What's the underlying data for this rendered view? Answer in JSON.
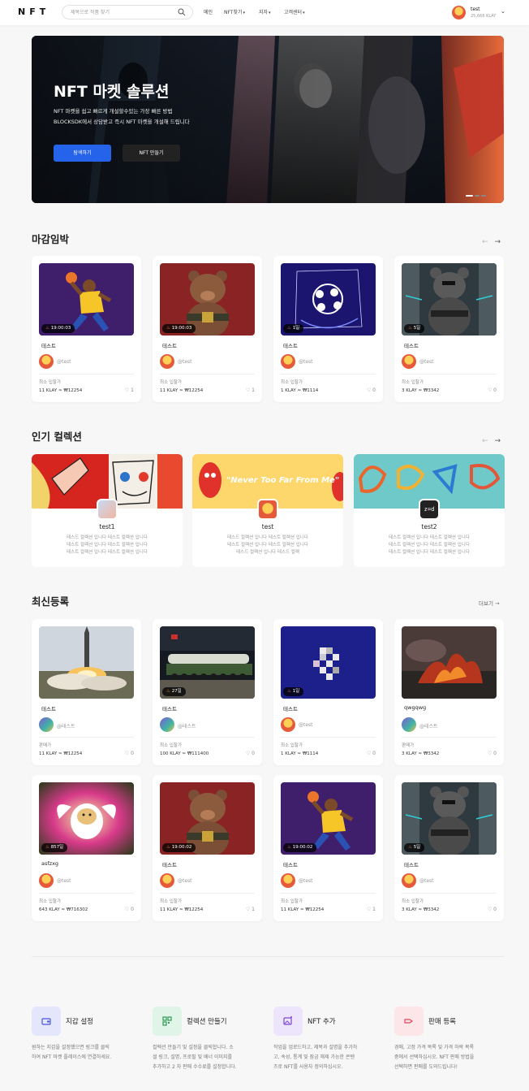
{
  "header": {
    "logo": "NFT",
    "search_placeholder": "제목으로 작품 찾기",
    "nav": [
      "메인",
      "NFT찾기",
      "지자",
      "고객센터"
    ],
    "user_name": "test",
    "user_balance": "25,666 KLAY"
  },
  "hero": {
    "title": "NFT 마켓 솔루션",
    "desc1": "NFT 마켓을 쉽고 빠르게 개설할수있는 가장 빠른 방법",
    "desc2": "BLOCKSDK에서 상담받고 즉시 NFT 마켓을 개설해 드립니다",
    "btn_explore": "탐색하기",
    "btn_create": "NFT 만들기"
  },
  "deadline": {
    "title": "마감임박",
    "cards": [
      {
        "badge": "19:00:03",
        "title": "테스트",
        "owner": "@test",
        "label": "최소 입찰가",
        "price": "11 KLAY ≈ ₩12254",
        "likes": "1"
      },
      {
        "badge": "19:00:03",
        "title": "테스트",
        "owner": "@test",
        "label": "최소 입찰가",
        "price": "11 KLAY ≈ ₩12254",
        "likes": "1"
      },
      {
        "badge": "1일",
        "title": "테스트",
        "owner": "@test",
        "label": "최소 입찰가",
        "price": "1 KLAY ≈ ₩1114",
        "likes": "0"
      },
      {
        "badge": "5일",
        "title": "테스트",
        "owner": "@test",
        "label": "최소 입찰가",
        "price": "3 KLAY ≈ ₩3342",
        "likes": "0"
      }
    ]
  },
  "popular": {
    "title": "인기 컬렉션",
    "banner2_text": "\"Never Too Far From Me\"",
    "logo3_text": "z=d",
    "collections": [
      {
        "name": "test1",
        "d1": "테스드 컬렉션 입니다 테스트 컬렉션 입니다",
        "d2": "테스트 컬렉션 입니다 테스트 컬렉션 입니다",
        "d3": "테스트 컬렉션 입니다 테스트 컬렉션 입니다"
      },
      {
        "name": "test",
        "d1": "테스드 컬렉션 입니다 테스트 컬렉션 입니다",
        "d2": "테스트 컬렉션 입니다 테스트 컬렉션 입니다",
        "d3": "테스드 컬렉션 입니다 테스드 컬렉"
      },
      {
        "name": "test2",
        "d1": "테스트 컬렉션 입니다 테스트 컬렉션 입니다",
        "d2": "테스트 컬렉션 입니다 테스트 컬렉션 입니다",
        "d3": "테스트 컬렉션 입니다 테스트 컬렉션 입니다"
      }
    ]
  },
  "latest": {
    "title": "최신등록",
    "more": "더보기",
    "cards": [
      {
        "badge": "",
        "title": "테스트",
        "owner": "@테스트",
        "label": "판매가",
        "price": "11 KLAY ≈ ₩12254",
        "likes": "0"
      },
      {
        "badge": "27일",
        "title": "테스트",
        "owner": "@테스트",
        "label": "최소 입찰가",
        "price": "100 KLAY ≈ ₩111400",
        "likes": "0"
      },
      {
        "badge": "1일",
        "title": "테스트",
        "owner": "@test",
        "label": "최소 입찰가",
        "price": "1 KLAY ≈ ₩1114",
        "likes": "0"
      },
      {
        "badge": "",
        "title": "qwgqwg",
        "owner": "@테스트",
        "label": "판매가",
        "price": "3 KLAY ≈ ₩3342",
        "likes": "0"
      },
      {
        "badge": "857일",
        "title": "asfzxg",
        "owner": "@test",
        "label": "최소 입찰가",
        "price": "643 KLAY ≈ ₩716302",
        "likes": "0"
      },
      {
        "badge": "19:00:02",
        "title": "테스트",
        "owner": "@test",
        "label": "최소 입찰가",
        "price": "11 KLAY ≈ ₩12254",
        "likes": "1"
      },
      {
        "badge": "19:00:02",
        "title": "테스트",
        "owner": "@test",
        "label": "최소 입찰가",
        "price": "11 KLAY ≈ ₩12254",
        "likes": "1"
      },
      {
        "badge": "5일",
        "title": "테스트",
        "owner": "@test",
        "label": "최소 입찰가",
        "price": "3 KLAY ≈ ₩3342",
        "likes": "0"
      }
    ]
  },
  "features": [
    {
      "title": "지갑 설정",
      "d1": "원하는 지갑을 설정했으면 링크를 클릭",
      "d2": "하여 NFT 마켓 플레이스에 연결하세요.",
      "d3": "",
      "color": "#e4e6fb",
      "icon": "wallet-icon"
    },
    {
      "title": "컬렉션 만들기",
      "d1": "컬렉션 만들기 및 설정을 클릭합니다. 소",
      "d2": "셜 링크, 설명, 프로필 및 배너 이미지를",
      "d3": "추가하고 2 차 판매 수수료를 설정합니다.",
      "color": "#e1f4e8",
      "icon": "collection-icon"
    },
    {
      "title": "NFT 추가",
      "d1": "작업을 업로드하고, 제목과 설명을 추가하",
      "d2": "고, 속성, 통계 및 잠금 해제 가능한 콘텐",
      "d3": "츠로 NFT를 사용자 정의하십시오.",
      "color": "#ece5fb",
      "icon": "image-add-icon"
    },
    {
      "title": "판매 등록",
      "d1": "경매, 고정 가격 목록 및 가격 하락 목록",
      "d2": "중에서 선택하십시오. NFT 판매 방법을",
      "d3": "선택하면 판매를 도와드립니다!",
      "color": "#fce6e8",
      "icon": "tag-icon"
    }
  ]
}
